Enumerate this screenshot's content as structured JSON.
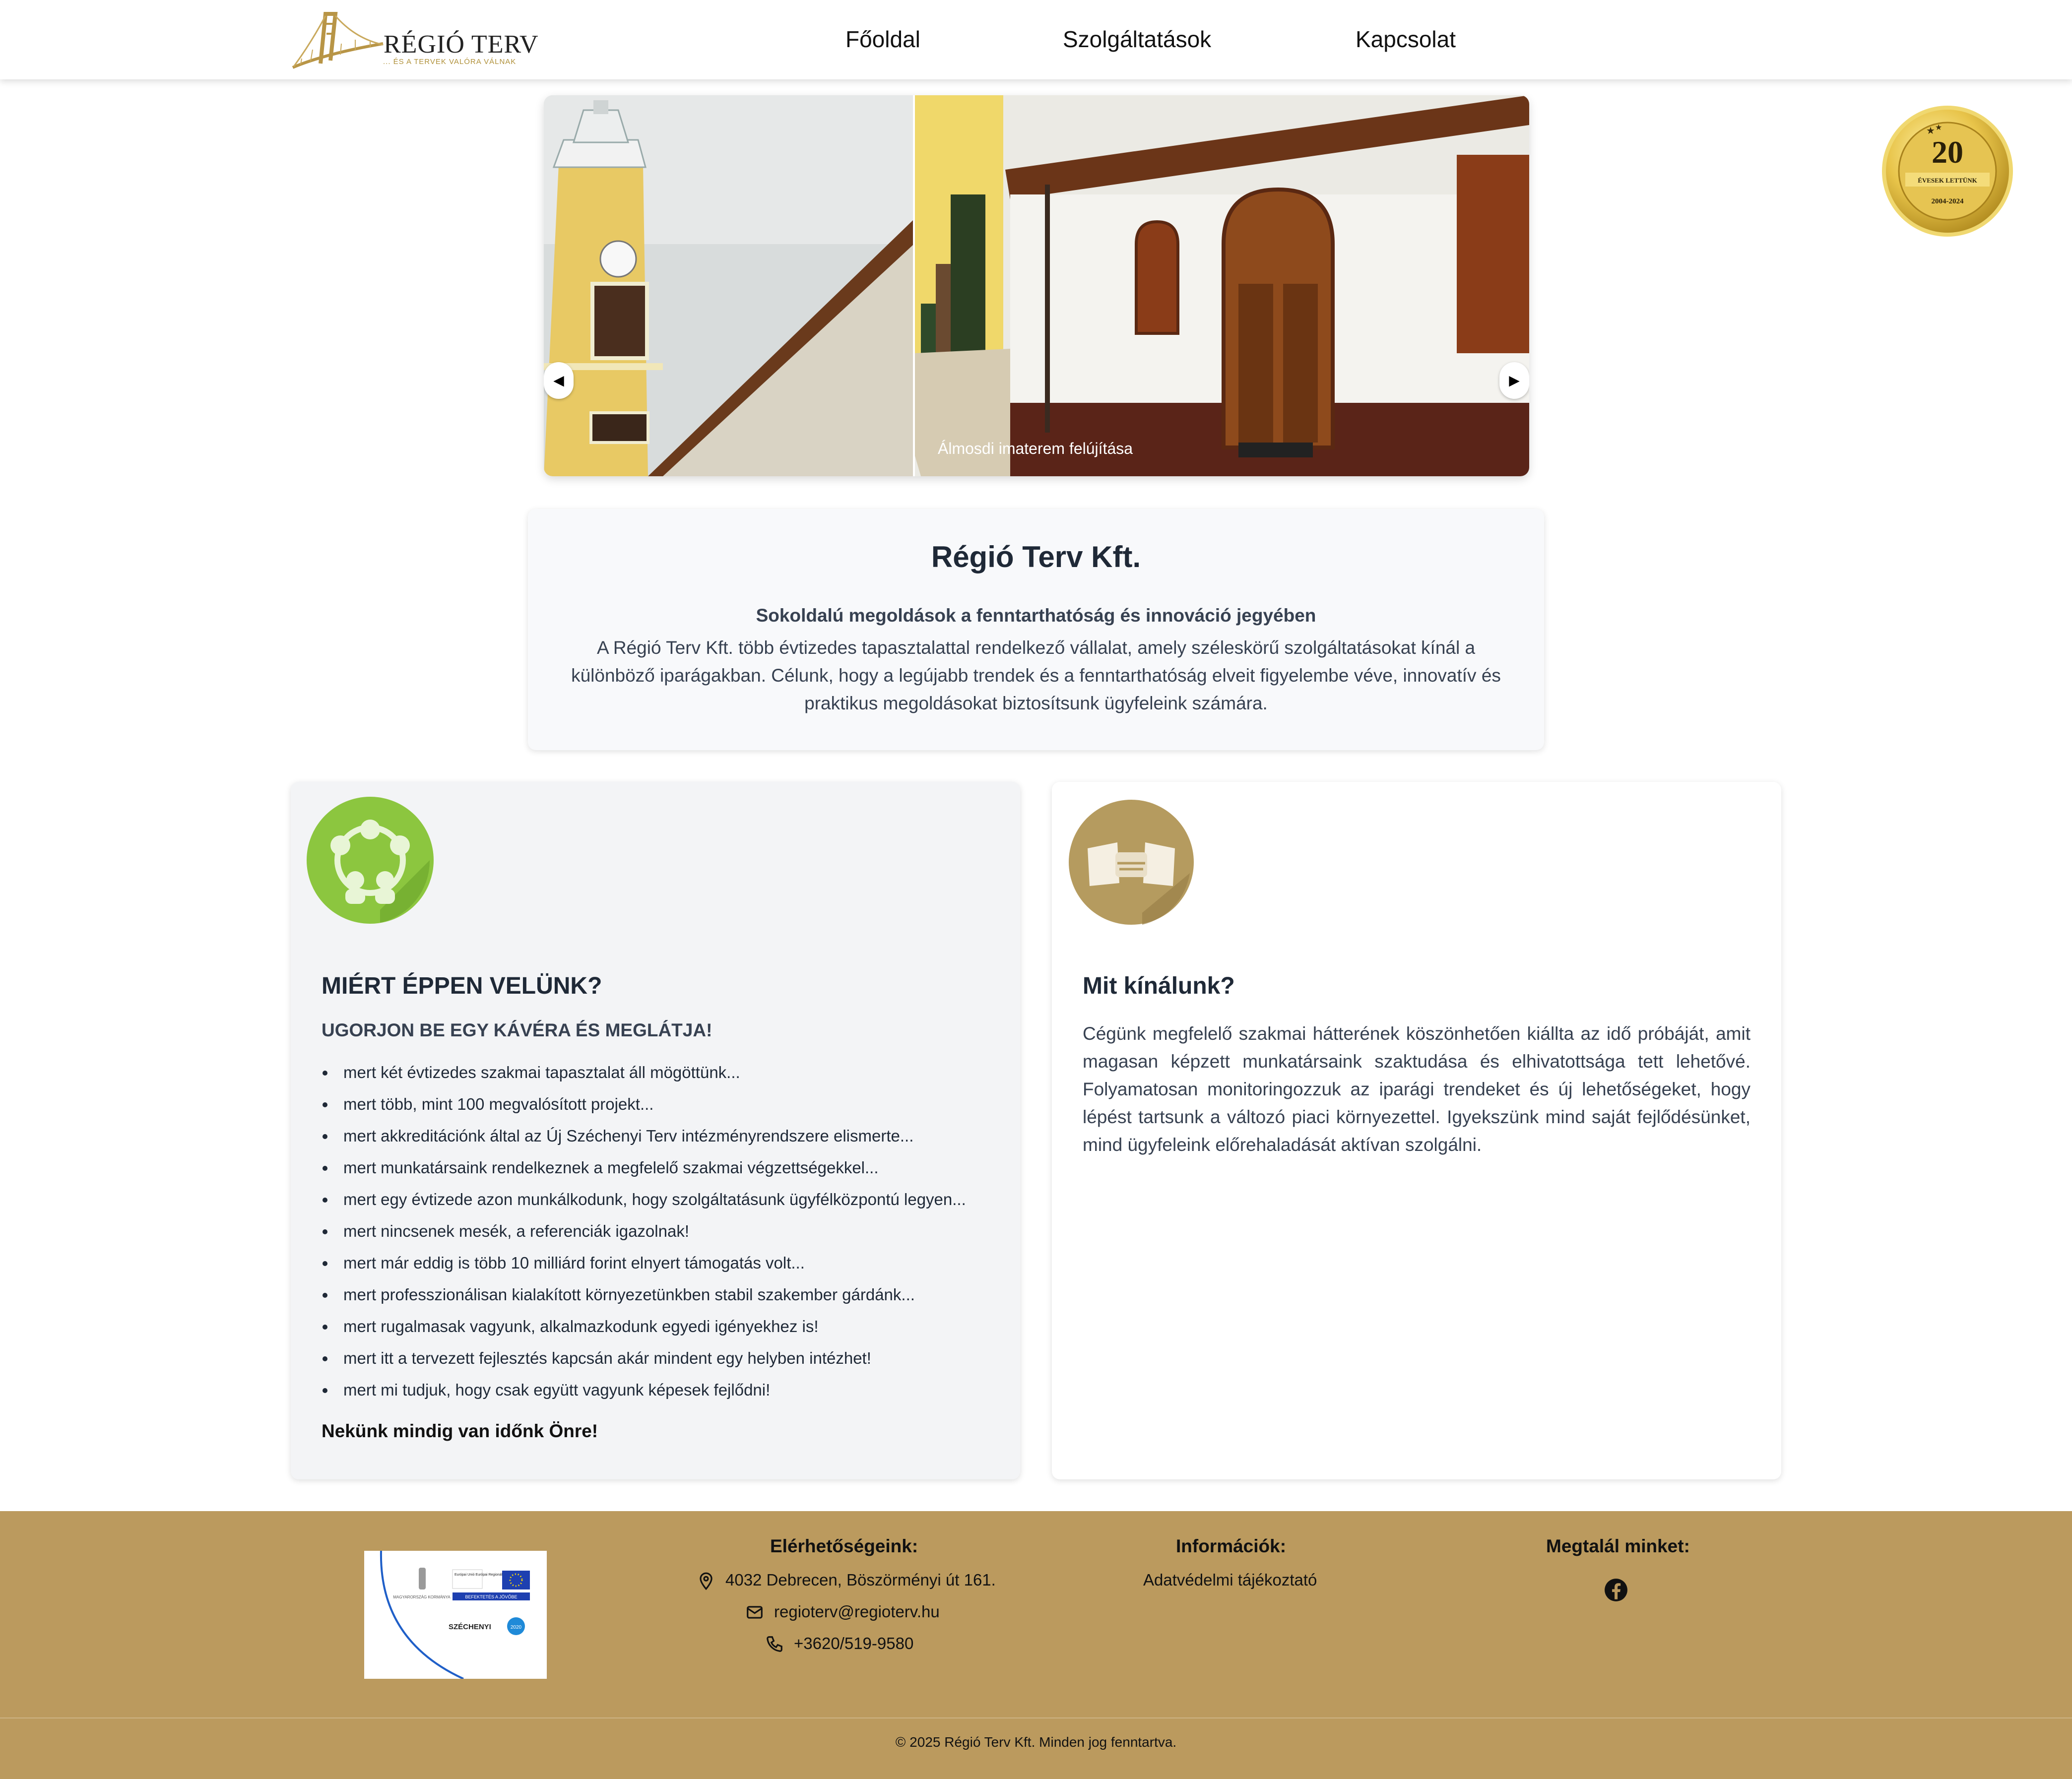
{
  "header": {
    "logo": {
      "name": "RÉGIÓ TERV",
      "tagline": "... ÉS A TERVEK VALÓRA VÁLNAK"
    },
    "nav": [
      {
        "label": "Főoldal"
      },
      {
        "label": "Szolgáltatások"
      },
      {
        "label": "Kapcsolat"
      }
    ]
  },
  "badge": {
    "number": "20",
    "text": "ÉVESEK LETTÜNK",
    "years": "2004-2024"
  },
  "slider": {
    "caption": "Álmosdi imaterem felújítása",
    "prev": "◀",
    "next": "▶"
  },
  "intro": {
    "title": "Régió Terv Kft.",
    "subtitle": "Sokoldalú megoldások a fenntarthatóság és innováció jegyében",
    "text": "A Régió Terv Kft. több évtizedes tapasztalattal rendelkező vállalat, amely széleskörű szolgáltatásokat kínál a különböző iparágakban. Célunk, hogy a legújabb trendek és a fenntarthatóság elveit figyelembe véve, innovatív és praktikus megoldásokat biztosítsunk ügyfeleink számára."
  },
  "why": {
    "title": "MIÉRT ÉPPEN VELÜNK?",
    "subtitle": "UGORJON BE EGY KÁVÉRA ÉS MEGLÁTJA!",
    "items": [
      "mert két évtizedes szakmai tapasztalat áll mögöttünk...",
      "mert több, mint 100 megvalósított projekt...",
      "mert akkreditációnk által az Új Széchenyi Terv intézményrendszere elismerte...",
      "mert munkatársaink rendelkeznek a megfelelő szakmai végzettségekkel...",
      "mert egy évtizede azon munkálkodunk, hogy szolgáltatásunk ügyfélközpontú legyen...",
      "mert nincsenek mesék, a referenciák igazolnak!",
      "mert már eddig is több 10 milliárd forint elnyert támogatás volt...",
      "mert professzionálisan kialakított környezetünkben stabil szakember gárdánk...",
      "mert rugalmasak vagyunk, alkalmazkodunk egyedi igényekhez is!",
      "mert itt a tervezett fejlesztés kapcsán akár mindent egy helyben intézhet!",
      "mert mi tudjuk, hogy csak együtt vagyunk képesek fejlődni!"
    ],
    "closing": "Nekünk mindig van időnk Önre!"
  },
  "offer": {
    "title": "Mit kínálunk?",
    "text": "Cégünk megfelelő szakmai hátterének köszönhetően kiállta az idő próbáját, amit magasan képzett munkatársaink szaktudása és elhivatottsága tett lehetővé. Folyamatosan monitoringozzuk az iparági trendeket és új lehetőségeket, hogy lépést tartsunk a változó piaci környezettel. Igyekszünk mind saját fejlődésünket, mind ügyfeleink előrehaladását aktívan szolgálni."
  },
  "footer": {
    "sponsor": {
      "line1": "MAGYARORSZÁG KORMÁNYA",
      "line2": "Európai Unió Európai Regionális Fejlesztési Alap",
      "line3": "BEFEKTETÉS A JÖVŐBE",
      "line4": "SZÉCHENYI",
      "line5": "2020"
    },
    "contact_title": "Elérhetőségeink:",
    "address": "4032 Debrecen, Böszörményi út 161.",
    "email": "regioterv@regioterv.hu",
    "phone": "+3620/519-9580",
    "info_title": "Információk:",
    "privacy": "Adatvédelmi tájékoztató",
    "social_title": "Megtalál minket:",
    "copyright": "© 2025 Régió Terv Kft. Minden jog fenntartva."
  },
  "colors": {
    "gold": "#bb9a5e",
    "green": "#8cc63f",
    "tan": "#b59b5f",
    "text": "#1f2937"
  }
}
